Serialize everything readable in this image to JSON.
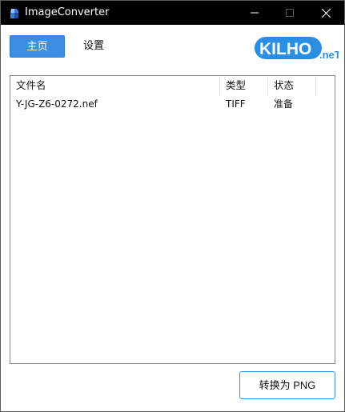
{
  "window": {
    "title": "ImageConverter"
  },
  "tabs": {
    "home_label": "主页",
    "settings_label": "设置"
  },
  "logo": {
    "brand": "KILHO",
    "suffix": ".neT",
    "color": "#2a8fe3"
  },
  "file_list": {
    "columns": [
      "文件名",
      "类型",
      "状态"
    ],
    "rows": [
      {
        "name": "Y-JG-Z6-0272.nef",
        "type": "TIFF",
        "status": "准备"
      }
    ]
  },
  "actions": {
    "convert_label": "转换为 PNG"
  },
  "colors": {
    "accent": "#3c8ee0",
    "titlebar": "#000000"
  }
}
